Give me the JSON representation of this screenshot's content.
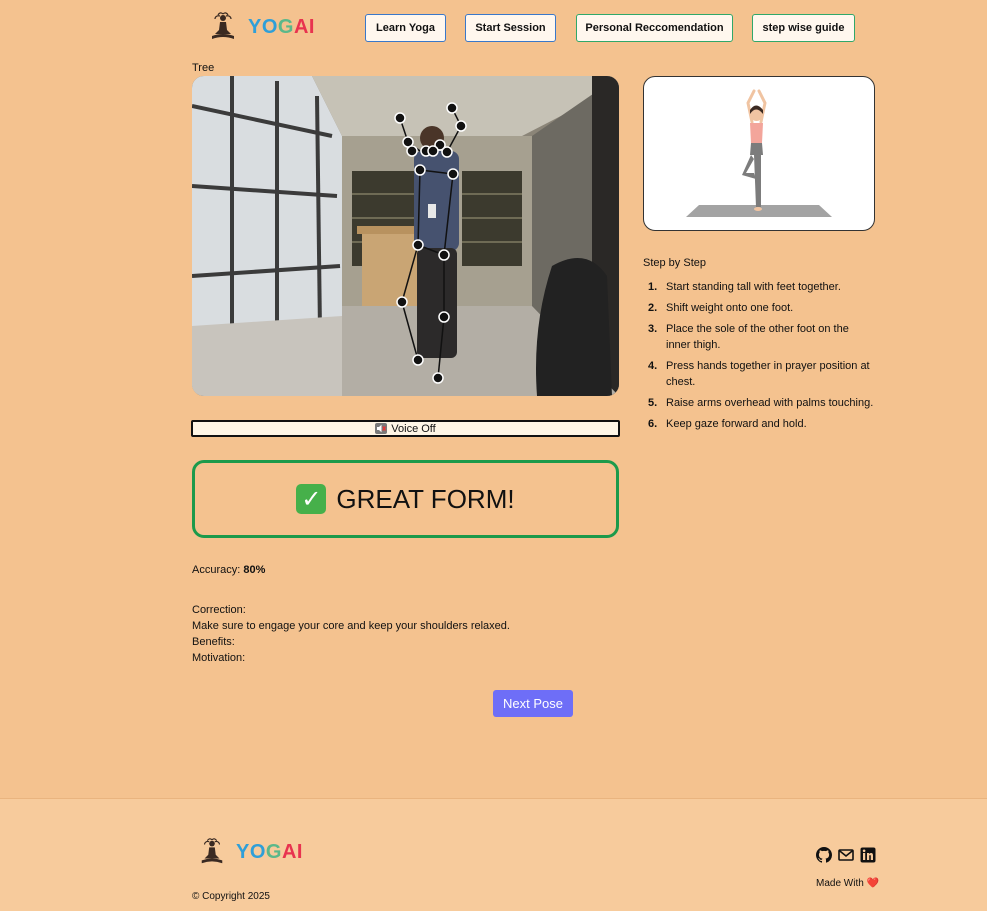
{
  "header": {
    "logo": {
      "part1": "YO",
      "part2": "G",
      "part3": "AI"
    },
    "nav": [
      {
        "label": "Learn Yoga"
      },
      {
        "label": "Start Session"
      },
      {
        "label": "Personal Reccomendation"
      },
      {
        "label": "step wise guide"
      }
    ]
  },
  "session": {
    "pose_name": "Tree",
    "voice_label": "Voice Off",
    "feedback": "GREAT FORM!",
    "accuracy_label": "Accuracy:",
    "accuracy_value": "80%",
    "correction_label": "Correction:",
    "correction_text": "Make sure to engage your core and keep your shoulders relaxed.",
    "benefits_label": "Benefits:",
    "motivation_label": "Motivation:",
    "next_label": "Next Pose"
  },
  "guide": {
    "title": "Step by Step",
    "steps": [
      {
        "num": "1.",
        "text": "Start standing tall with feet together."
      },
      {
        "num": "2.",
        "text": "Shift weight onto one foot."
      },
      {
        "num": "3.",
        "text": "Place the sole of the other foot on the inner thigh."
      },
      {
        "num": "4.",
        "text": "Press hands together in prayer position at chest."
      },
      {
        "num": "5.",
        "text": "Raise arms overhead with palms touching."
      },
      {
        "num": "6.",
        "text": "Keep gaze forward and hold."
      }
    ]
  },
  "footer": {
    "logo": {
      "part1": "YO",
      "part2": "G",
      "part3": "AI"
    },
    "copyright": "© Copyright 2025",
    "made_with": "Made With",
    "heart": "❤️",
    "icons": [
      "github-icon",
      "mail-icon",
      "linkedin-icon"
    ]
  },
  "colors": {
    "background": "#f4c28f",
    "feedback_border": "#1c9a4b",
    "next_button": "#6e6ef7",
    "logo_blue": "#2f9fd8",
    "logo_green": "#5bb88a",
    "logo_red": "#e8334f"
  }
}
